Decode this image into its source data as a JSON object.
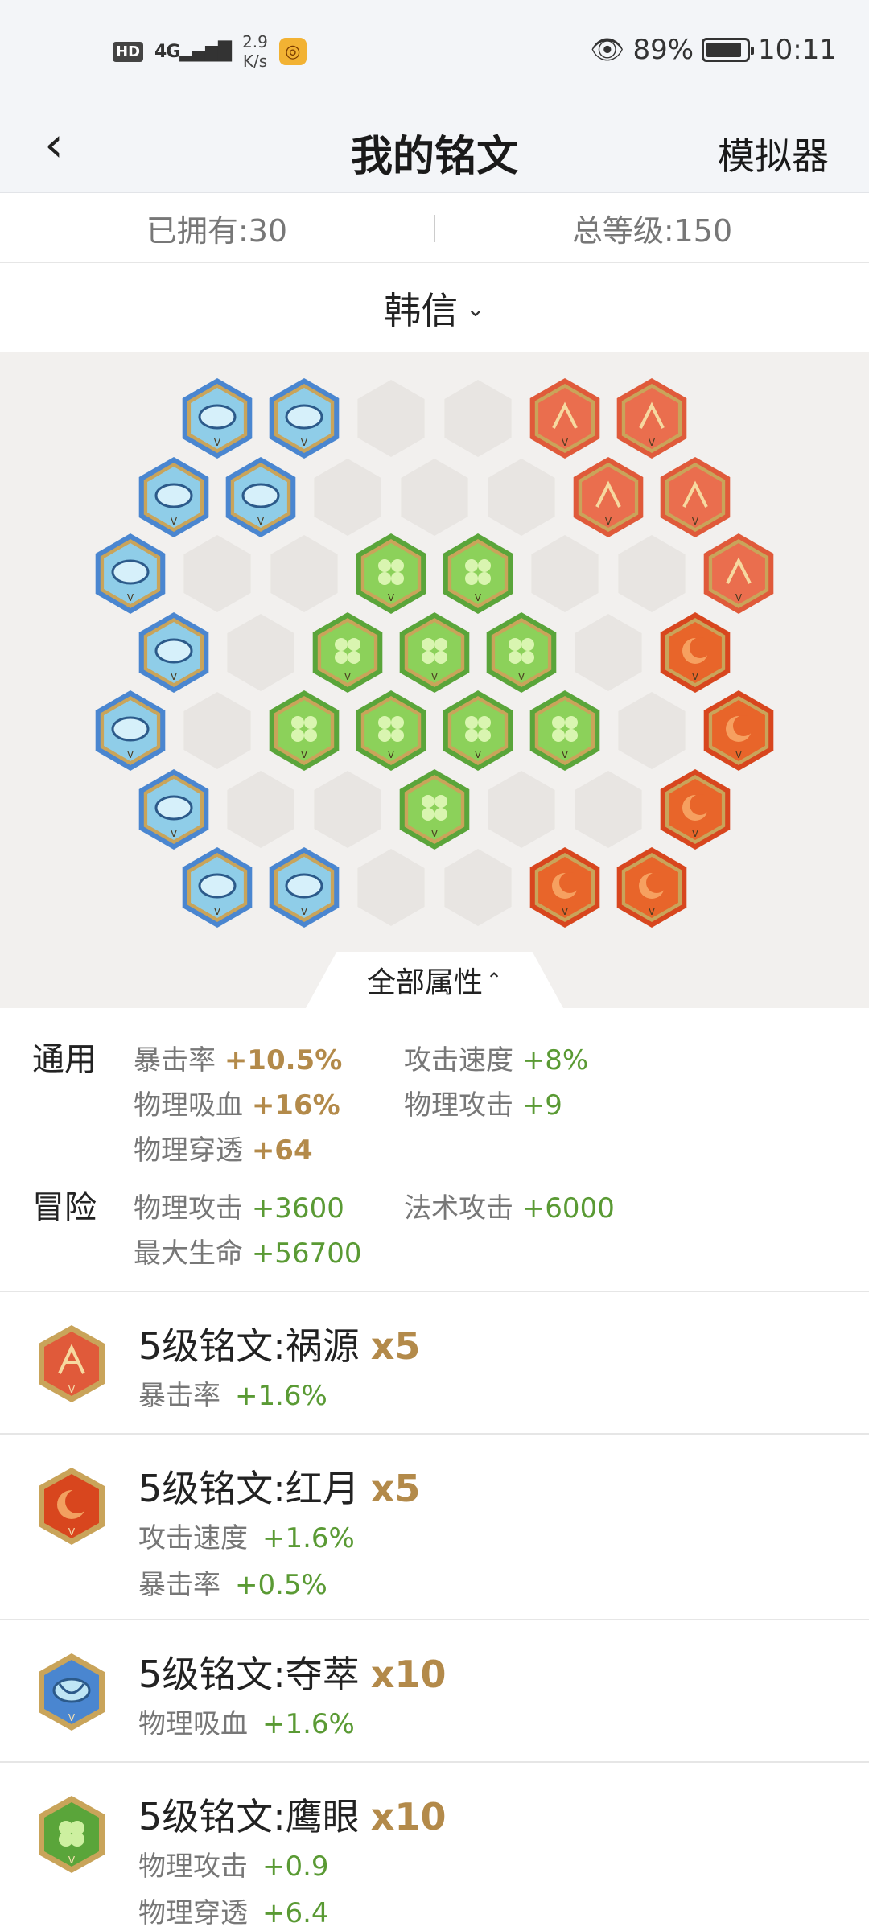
{
  "status_bar": {
    "hd": "HD",
    "signal": "4G",
    "net_speed": "2.9",
    "net_unit": "K/s",
    "battery_text": "89%",
    "battery_level": 0.89,
    "time": "10:11"
  },
  "nav": {
    "title": "我的铭文",
    "simulator": "模拟器"
  },
  "summary": {
    "owned": "已拥有:30",
    "total_level": "总等级:150"
  },
  "hero": {
    "name": "韩信",
    "chevron": "⌄"
  },
  "all_attributes_label": "全部属性",
  "attributes": {
    "general_label": "通用",
    "general": [
      {
        "name": "暴击率",
        "value": "+10.5%"
      },
      {
        "name": "攻击速度",
        "value": "+8%"
      },
      {
        "name": "物理吸血",
        "value": "+16%"
      },
      {
        "name": "物理攻击",
        "value": "+9"
      },
      {
        "name": "物理穿透",
        "value": "+64"
      }
    ],
    "adventure_label": "冒险",
    "adventure": [
      {
        "name": "物理攻击",
        "value": "+3600"
      },
      {
        "name": "法术攻击",
        "value": "+6000"
      },
      {
        "name": "最大生命",
        "value": "+56700"
      }
    ]
  },
  "inscriptions": [
    {
      "name": "5级铭文:祸源",
      "qty": "x5",
      "color": "#e05a3a",
      "icon": "red-cards-icon",
      "stats": [
        {
          "name": "暴击率",
          "value": "+1.6%"
        }
      ]
    },
    {
      "name": "5级铭文:红月",
      "qty": "x5",
      "color": "#d8461e",
      "icon": "red-moon-icon",
      "stats": [
        {
          "name": "攻击速度",
          "value": "+1.6%"
        },
        {
          "name": "暴击率",
          "value": "+0.5%"
        }
      ]
    },
    {
      "name": "5级铭文:夺萃",
      "qty": "x10",
      "color": "#4a86d0",
      "icon": "blue-knot-icon",
      "stats": [
        {
          "name": "物理吸血",
          "value": "+1.6%"
        }
      ]
    },
    {
      "name": "5级铭文:鹰眼",
      "qty": "x10",
      "color": "#5aa53a",
      "icon": "green-clover-icon",
      "stats": [
        {
          "name": "物理攻击",
          "value": "+0.9"
        },
        {
          "name": "物理穿透",
          "value": "+6.4"
        }
      ]
    }
  ],
  "colors": {
    "gold": "#b38a4a",
    "green": "#5a9a34",
    "blue_gem": "#4a86d0",
    "red_gem": "#e05a3a",
    "moon_gem": "#d8461e",
    "green_gem": "#5aa53a"
  }
}
